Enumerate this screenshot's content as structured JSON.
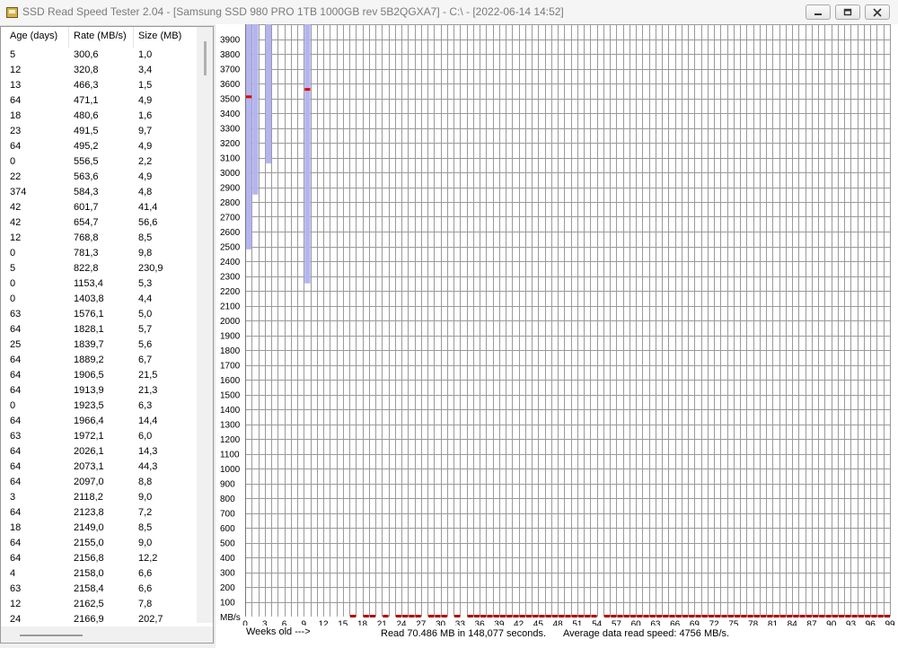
{
  "window": {
    "title": "SSD Read Speed Tester 2.04 - [Samsung SSD 980 PRO 1TB 1000GB rev 5B2QGXA7] - C:\\ - [2022-06-14 14:52]",
    "icon": "drive-icon"
  },
  "table": {
    "columns": [
      "Age (days)",
      "Rate (MB/s)",
      "Size (MB)"
    ],
    "rows": [
      [
        "5",
        "300,6",
        "1,0"
      ],
      [
        "12",
        "320,8",
        "3,4"
      ],
      [
        "13",
        "466,3",
        "1,5"
      ],
      [
        "64",
        "471,1",
        "4,9"
      ],
      [
        "18",
        "480,6",
        "1,6"
      ],
      [
        "23",
        "491,5",
        "9,7"
      ],
      [
        "64",
        "495,2",
        "4,9"
      ],
      [
        "0",
        "556,5",
        "2,2"
      ],
      [
        "22",
        "563,6",
        "4,9"
      ],
      [
        "374",
        "584,3",
        "4,8"
      ],
      [
        "42",
        "601,7",
        "41,4"
      ],
      [
        "42",
        "654,7",
        "56,6"
      ],
      [
        "12",
        "768,8",
        "8,5"
      ],
      [
        "0",
        "781,3",
        "9,8"
      ],
      [
        "5",
        "822,8",
        "230,9"
      ],
      [
        "0",
        "1153,4",
        "5,3"
      ],
      [
        "0",
        "1403,8",
        "4,4"
      ],
      [
        "63",
        "1576,1",
        "5,0"
      ],
      [
        "64",
        "1828,1",
        "5,7"
      ],
      [
        "25",
        "1839,7",
        "5,6"
      ],
      [
        "64",
        "1889,2",
        "6,7"
      ],
      [
        "64",
        "1906,5",
        "21,5"
      ],
      [
        "64",
        "1913,9",
        "21,3"
      ],
      [
        "0",
        "1923,5",
        "6,3"
      ],
      [
        "64",
        "1966,4",
        "14,4"
      ],
      [
        "63",
        "1972,1",
        "6,0"
      ],
      [
        "64",
        "2026,1",
        "14,3"
      ],
      [
        "64",
        "2073,1",
        "44,3"
      ],
      [
        "64",
        "2097,0",
        "8,8"
      ],
      [
        "3",
        "2118,2",
        "9,0"
      ],
      [
        "64",
        "2123,8",
        "7,2"
      ],
      [
        "18",
        "2149,0",
        "8,5"
      ],
      [
        "64",
        "2155,0",
        "9,0"
      ],
      [
        "64",
        "2156,8",
        "12,2"
      ],
      [
        "4",
        "2158,0",
        "6,6"
      ],
      [
        "63",
        "2158,4",
        "6,6"
      ],
      [
        "12",
        "2162,5",
        "7,8"
      ],
      [
        "24",
        "2166,9",
        "202,7"
      ]
    ]
  },
  "chart_data": {
    "type": "bar",
    "ylabel": "MB/s",
    "xlabel": "Weeks old --->",
    "ylim": [
      0,
      4000
    ],
    "y_ticks": [
      100,
      200,
      300,
      400,
      500,
      600,
      700,
      800,
      900,
      1000,
      1100,
      1200,
      1300,
      1400,
      1500,
      1600,
      1700,
      1800,
      1900,
      2000,
      2100,
      2200,
      2300,
      2400,
      2500,
      2600,
      2700,
      2800,
      2900,
      3000,
      3100,
      3200,
      3300,
      3400,
      3500,
      3600,
      3700,
      3800,
      3900
    ],
    "x_ticks": [
      0,
      3,
      6,
      9,
      12,
      15,
      18,
      21,
      24,
      27,
      30,
      33,
      36,
      39,
      42,
      45,
      48,
      51,
      54,
      57,
      60,
      63,
      66,
      69,
      72,
      75,
      78,
      81,
      84,
      87,
      90,
      93,
      96,
      99
    ],
    "grid": true,
    "series": [
      {
        "range_bars": [
          {
            "week": 0,
            "min": 2480,
            "max": 4000
          },
          {
            "week": 1,
            "min": 2850,
            "max": 4000
          },
          {
            "week": 3,
            "min": 3060,
            "max": 4000
          },
          {
            "week": 9,
            "min": 2250,
            "max": 4000
          }
        ]
      },
      {
        "avg_marks": [
          {
            "week": 0,
            "value": 3510
          },
          {
            "week": 9,
            "value": 3560
          },
          {
            "week": 16,
            "value": 0
          },
          {
            "week": 18,
            "value": 0
          },
          {
            "week": 19,
            "value": 0
          },
          {
            "week": 21,
            "value": 0
          },
          {
            "week": 23,
            "value": 0
          },
          {
            "week": 24,
            "value": 0
          },
          {
            "week": 25,
            "value": 0
          },
          {
            "week": 26,
            "value": 0
          },
          {
            "week": 28,
            "value": 0
          },
          {
            "week": 29,
            "value": 0
          },
          {
            "week": 30,
            "value": 0
          },
          {
            "week": 32,
            "value": 0
          },
          {
            "week": 34,
            "value": 0
          },
          {
            "week": 35,
            "value": 0
          },
          {
            "week": 36,
            "value": 0
          },
          {
            "week": 37,
            "value": 0
          },
          {
            "week": 38,
            "value": 0
          },
          {
            "week": 39,
            "value": 0
          },
          {
            "week": 40,
            "value": 0
          },
          {
            "week": 41,
            "value": 0
          },
          {
            "week": 42,
            "value": 0
          },
          {
            "week": 43,
            "value": 0
          },
          {
            "week": 44,
            "value": 0
          },
          {
            "week": 45,
            "value": 0
          },
          {
            "week": 46,
            "value": 0
          },
          {
            "week": 47,
            "value": 0
          },
          {
            "week": 48,
            "value": 0
          },
          {
            "week": 49,
            "value": 0
          },
          {
            "week": 50,
            "value": 0
          },
          {
            "week": 51,
            "value": 0
          },
          {
            "week": 52,
            "value": 0
          },
          {
            "week": 53,
            "value": 0
          },
          {
            "week": 55,
            "value": 0
          },
          {
            "week": 56,
            "value": 0
          },
          {
            "week": 57,
            "value": 0
          },
          {
            "week": 58,
            "value": 0
          },
          {
            "week": 59,
            "value": 0
          },
          {
            "week": 60,
            "value": 0
          },
          {
            "week": 61,
            "value": 0
          },
          {
            "week": 62,
            "value": 0
          },
          {
            "week": 63,
            "value": 0
          },
          {
            "week": 64,
            "value": 0
          },
          {
            "week": 65,
            "value": 0
          },
          {
            "week": 66,
            "value": 0
          },
          {
            "week": 67,
            "value": 0
          },
          {
            "week": 68,
            "value": 0
          },
          {
            "week": 69,
            "value": 0
          },
          {
            "week": 70,
            "value": 0
          },
          {
            "week": 71,
            "value": 0
          },
          {
            "week": 72,
            "value": 0
          },
          {
            "week": 73,
            "value": 0
          },
          {
            "week": 74,
            "value": 0
          },
          {
            "week": 75,
            "value": 0
          },
          {
            "week": 76,
            "value": 0
          },
          {
            "week": 77,
            "value": 0
          },
          {
            "week": 78,
            "value": 0
          },
          {
            "week": 79,
            "value": 0
          },
          {
            "week": 80,
            "value": 0
          },
          {
            "week": 81,
            "value": 0
          },
          {
            "week": 82,
            "value": 0
          },
          {
            "week": 83,
            "value": 0
          },
          {
            "week": 84,
            "value": 0
          },
          {
            "week": 85,
            "value": 0
          },
          {
            "week": 86,
            "value": 0
          },
          {
            "week": 87,
            "value": 0
          },
          {
            "week": 88,
            "value": 0
          },
          {
            "week": 89,
            "value": 0
          },
          {
            "week": 90,
            "value": 0
          },
          {
            "week": 91,
            "value": 0
          },
          {
            "week": 92,
            "value": 0
          },
          {
            "week": 93,
            "value": 0
          },
          {
            "week": 94,
            "value": 0
          },
          {
            "week": 95,
            "value": 0
          },
          {
            "week": 96,
            "value": 0
          },
          {
            "week": 97,
            "value": 0
          },
          {
            "week": 98,
            "value": 0
          }
        ]
      }
    ],
    "colors": {
      "range_bar": "#b4b4f0",
      "avg_mark": "#e00000",
      "baseline_mark": "#b00000",
      "grid": "#9a9a9a"
    }
  },
  "status": {
    "read_stats": "Read 70.486 MB in 148,077 seconds.",
    "avg_speed": "Average data read speed: 4756 MB/s."
  }
}
